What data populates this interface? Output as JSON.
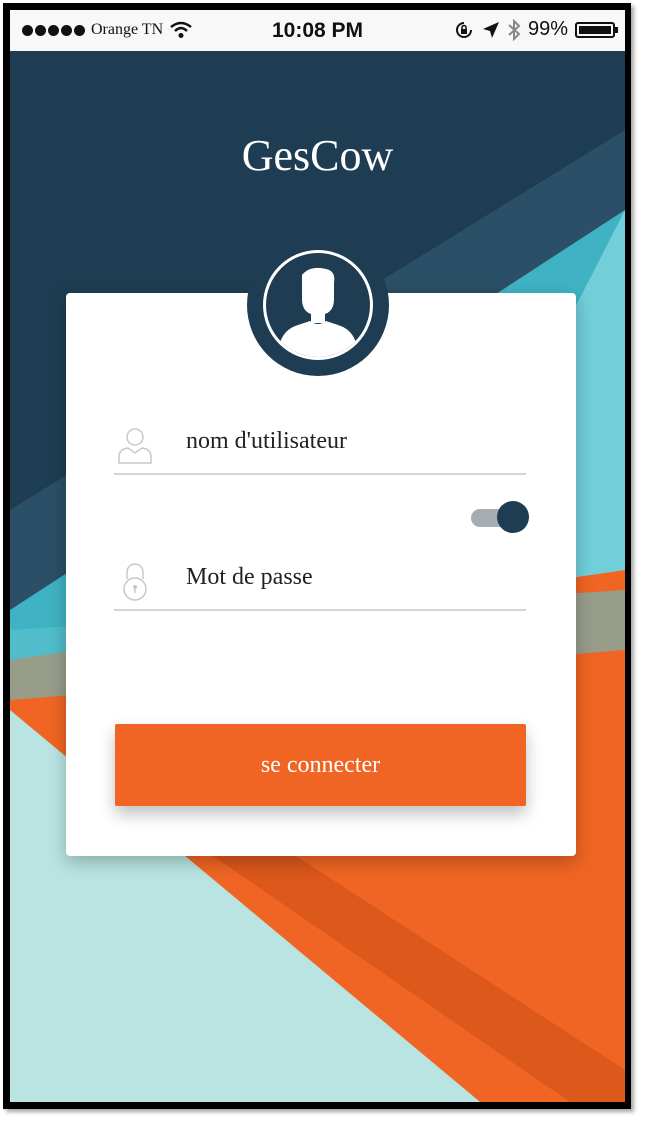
{
  "status_bar": {
    "carrier": "Orange TN",
    "time": "10:08 PM",
    "battery_percent": "99%",
    "icons": [
      "signal-dots-icon",
      "wifi-icon",
      "rotation-lock-icon",
      "location-arrow-icon",
      "bluetooth-icon",
      "battery-icon"
    ]
  },
  "app": {
    "title": "GesCow"
  },
  "login": {
    "avatar_icon": "user-avatar-icon",
    "username": {
      "placeholder": "nom d'utilisateur",
      "value": "",
      "icon": "user-icon"
    },
    "password_toggle": {
      "state": "on"
    },
    "password": {
      "placeholder": "Mot de passe",
      "value": "",
      "icon": "lock-icon"
    },
    "submit_label": "se connecter"
  },
  "colors": {
    "navy": "#1f3d52",
    "teal": "#3fb3c3",
    "light_teal": "#b9e4e2",
    "orange": "#f06523",
    "white": "#ffffff"
  }
}
